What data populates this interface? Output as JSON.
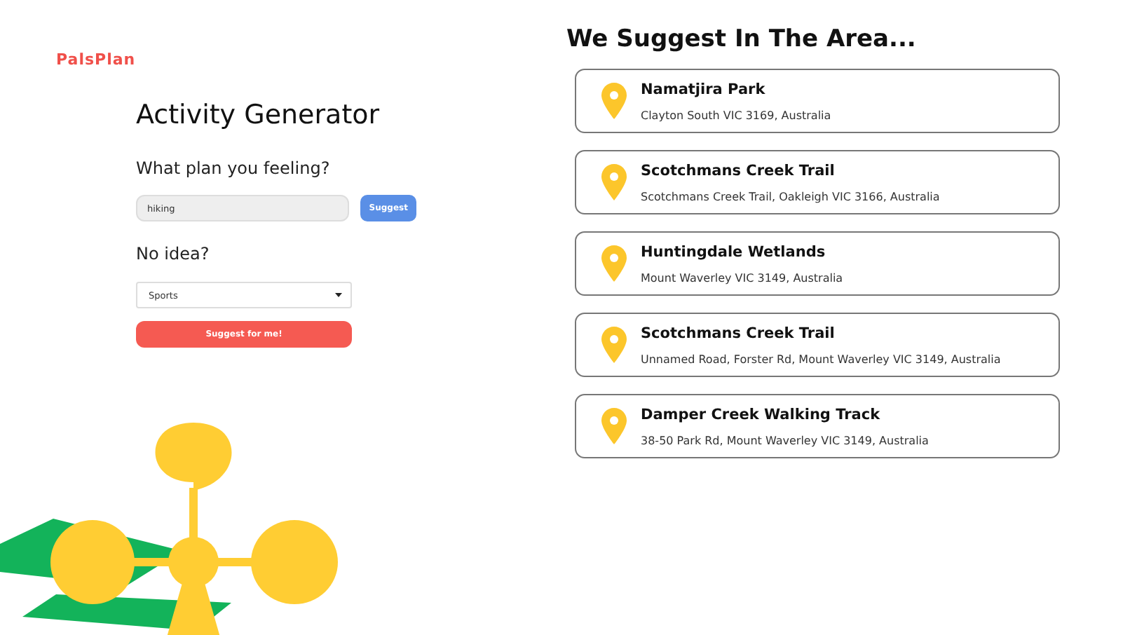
{
  "logo": "PalsPlan",
  "generator": {
    "title": "Activity Generator",
    "prompt": "What plan you feeling?",
    "input": {
      "value": "hiking"
    },
    "suggest_button": "Suggest",
    "alt_prompt": "No idea?",
    "category_select": {
      "value": "Sports"
    },
    "random_button": "Suggest for me!"
  },
  "results": {
    "heading": "We Suggest In The Area...",
    "places": [
      {
        "name": "Namatjira Park",
        "address": "Clayton South VIC 3169, Australia"
      },
      {
        "name": "Scotchmans Creek Trail",
        "address": "Scotchmans Creek Trail, Oakleigh VIC 3166, Australia"
      },
      {
        "name": "Huntingdale Wetlands",
        "address": "Mount Waverley VIC 3149, Australia"
      },
      {
        "name": "Scotchmans Creek Trail",
        "address": "Unnamed Road, Forster Rd, Mount Waverley VIC 3149, Australia"
      },
      {
        "name": "Damper Creek Walking Track",
        "address": "38-50 Park Rd, Mount Waverley VIC 3149, Australia"
      }
    ]
  }
}
